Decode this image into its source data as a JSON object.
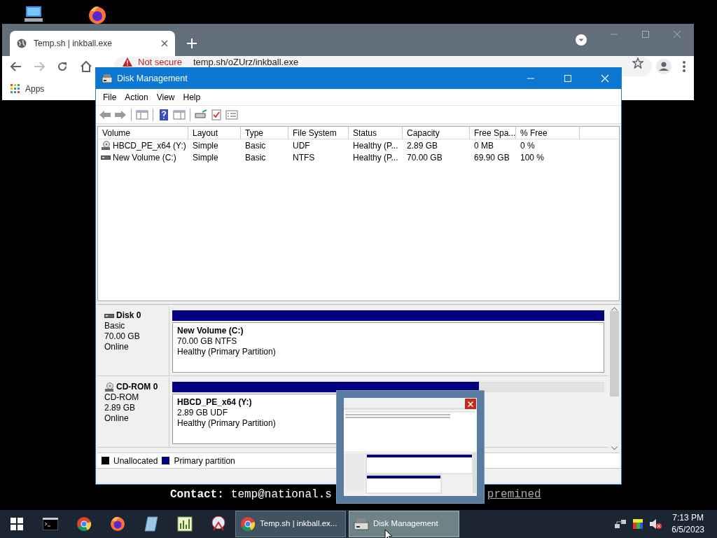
{
  "browser": {
    "tab": {
      "title": "Temp.sh | inkball.exe"
    },
    "address": {
      "warning": "Not secure",
      "url": "temp.sh/oZUrz/inkball.exe"
    },
    "bookmarks": [
      {
        "label": "Apps"
      }
    ],
    "page": {
      "contact_label": "Contact:",
      "contact_email": "temp@national.s",
      "link": "premined"
    }
  },
  "disk_management": {
    "title": "Disk Management",
    "menu": [
      "File",
      "Action",
      "View",
      "Help"
    ],
    "volume_list": {
      "columns": [
        "Volume",
        "Layout",
        "Type",
        "File System",
        "Status",
        "Capacity",
        "Free Spa...",
        "% Free"
      ],
      "rows": [
        {
          "kind": "cdrom",
          "cells": [
            "HBCD_PE_x64 (Y:)",
            "Simple",
            "Basic",
            "UDF",
            "Healthy (P...",
            "2.89 GB",
            "0 MB",
            "0 %"
          ]
        },
        {
          "kind": "disk",
          "cells": [
            "New Volume (C:)",
            "Simple",
            "Basic",
            "NTFS",
            "Healthy (P...",
            "70.00 GB",
            "69.90 GB",
            "100 %"
          ]
        }
      ]
    },
    "disks": [
      {
        "kind": "disk",
        "name": "Disk 0",
        "type": "Basic",
        "size": "70.00 GB",
        "status": "Online",
        "partition": {
          "name": "New Volume  (C:)",
          "detail": "70.00 GB NTFS",
          "health": "Healthy (Primary Partition)",
          "level": 1
        }
      },
      {
        "kind": "cdrom",
        "name": "CD-ROM 0",
        "type": "CD-ROM",
        "size": "2.89 GB",
        "status": "Online",
        "partition": {
          "name": "HBCD_PE_x64  (Y:)",
          "detail": "2.89 GB UDF",
          "health": "Healthy (Primary Partition)",
          "level": 0.71
        }
      }
    ],
    "legend": [
      {
        "label": "Unallocated",
        "color": "#000000"
      },
      {
        "label": "Primary partition",
        "color": "#000080"
      }
    ]
  },
  "taskbar": {
    "tasks": [
      {
        "kind": "chrome",
        "label": "Temp.sh | inkball.ex...",
        "selected": false
      },
      {
        "kind": "disk",
        "label": "Disk Management",
        "selected": true
      }
    ],
    "clock": {
      "time": "7:13 PM",
      "date": "6/5/2023"
    }
  }
}
